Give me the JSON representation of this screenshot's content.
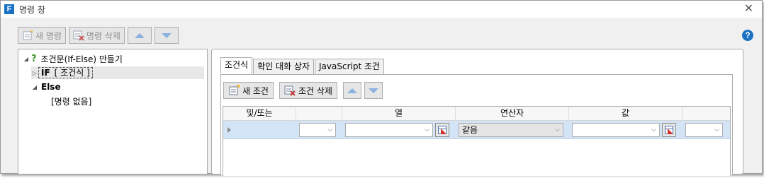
{
  "window": {
    "title": "명령 창",
    "app_icon_letter": "F"
  },
  "toolbar": {
    "new_command": "새 명령",
    "delete_command": "명령 삭제"
  },
  "tree": {
    "root_label": "조건문(If-Else) 만들기",
    "if_keyword": "IF",
    "if_condition": "[ 조건식 ]",
    "else_keyword": "Else",
    "else_child": "[명령 없음]"
  },
  "tabs": [
    {
      "label": "조건식",
      "active": true
    },
    {
      "label": "확인 대화 상자",
      "active": false
    },
    {
      "label": "JavaScript 조건",
      "active": false
    }
  ],
  "condition_toolbar": {
    "new_condition": "새 조건",
    "delete_condition": "조건 삭제"
  },
  "grid": {
    "columns": [
      "및/또는",
      "",
      "열",
      "연산자",
      "값",
      ""
    ],
    "row": {
      "and_or": "",
      "column": "",
      "operator": "같음",
      "value": "",
      "extra": ""
    }
  },
  "colors": {
    "accent": "#1b72c4",
    "selected_row": "#d4e4f7",
    "question_mark": "#3f9a2e"
  }
}
